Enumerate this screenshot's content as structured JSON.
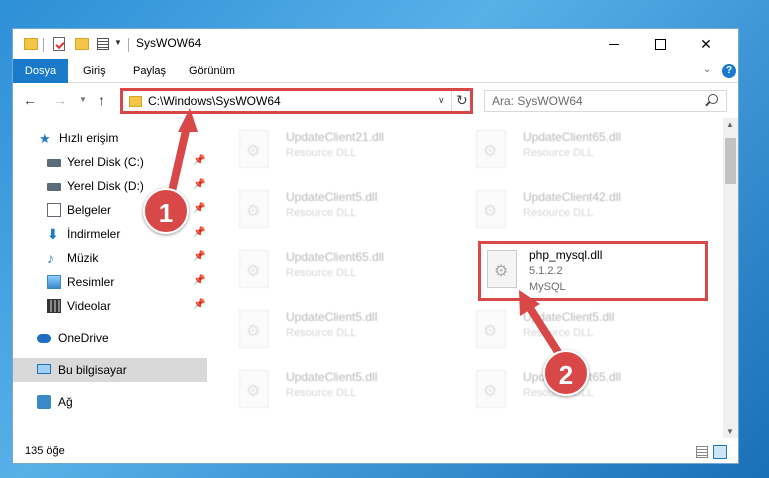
{
  "window": {
    "title": "SysWOW64"
  },
  "ribbon": {
    "tabs": [
      {
        "label": "Dosya"
      },
      {
        "label": "Giriş"
      },
      {
        "label": "Paylaş"
      },
      {
        "label": "Görünüm"
      }
    ]
  },
  "address_bar": {
    "path": "C:\\Windows\\SysWOW64"
  },
  "search": {
    "placeholder": "Ara: SysWOW64"
  },
  "sidebar": {
    "items": [
      {
        "label": "Hızlı erişim",
        "icon": "star-icon"
      },
      {
        "label": "Yerel Disk (C:)",
        "icon": "disk-icon",
        "pinned": true
      },
      {
        "label": "Yerel Disk (D:)",
        "icon": "disk-icon",
        "pinned": true
      },
      {
        "label": "Belgeler",
        "icon": "documents-icon",
        "pinned": true
      },
      {
        "label": "İndirmeler",
        "icon": "download-icon",
        "pinned": true
      },
      {
        "label": "Müzik",
        "icon": "music-icon",
        "pinned": true
      },
      {
        "label": "Resimler",
        "icon": "pictures-icon",
        "pinned": true
      },
      {
        "label": "Videolar",
        "icon": "videos-icon",
        "pinned": true
      },
      {
        "label": "OneDrive",
        "icon": "cloud-icon"
      },
      {
        "label": "Bu bilgisayar",
        "icon": "computer-icon",
        "selected": true
      },
      {
        "label": "Ağ",
        "icon": "network-icon"
      }
    ]
  },
  "files": [
    {
      "name": "UpdateClient21.dll",
      "desc": "Resource DLL"
    },
    {
      "name": "UpdateClient65.dll",
      "desc": "Resource DLL"
    },
    {
      "name": "UpdateClient5.dll",
      "desc": "Resource DLL"
    },
    {
      "name": "UpdateClient42.dll",
      "desc": "Resource DLL"
    },
    {
      "name": "UpdateClient65.dll",
      "desc": "Resource DLL"
    },
    {
      "name": "php_mysql.dll",
      "desc": "5.1.2.2",
      "desc2": "MySQL"
    },
    {
      "name": "UpdateClient5.dll",
      "desc": "Resource DLL"
    },
    {
      "name": "UpdateClient5.dll",
      "desc": "Resource DLL"
    },
    {
      "name": "UpdateClient5.dll",
      "desc": "Resource DLL"
    },
    {
      "name": "UpdateClient65.dll",
      "desc": "Resource DLL"
    }
  ],
  "status": {
    "item_count": "135 öğe"
  },
  "callouts": {
    "one": "1",
    "two": "2"
  },
  "colors": {
    "accent": "#1979ca",
    "callout_red": "#d94848"
  }
}
